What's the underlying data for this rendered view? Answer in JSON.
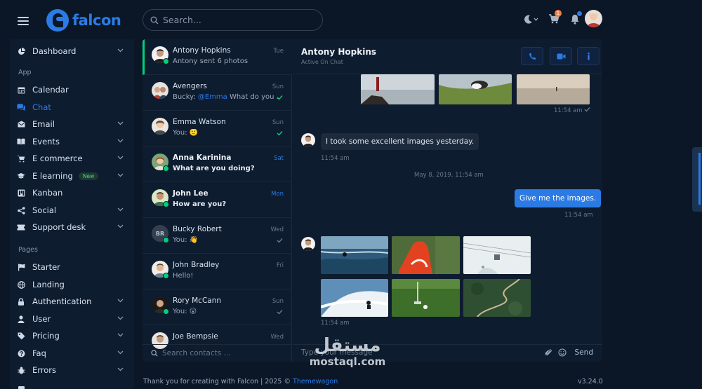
{
  "app": {
    "brand": "falcon"
  },
  "search": {
    "placeholder": "Search..."
  },
  "topbar": {
    "cart_count": "1"
  },
  "sidebar": {
    "items": [
      {
        "label": "Dashboard",
        "chev": true
      },
      {
        "label": "Calendar",
        "chev": false
      },
      {
        "label": "Chat",
        "chev": false,
        "active": true
      },
      {
        "label": "Email",
        "chev": true
      },
      {
        "label": "Events",
        "chev": true
      },
      {
        "label": "E commerce",
        "chev": true
      },
      {
        "label": "E learning",
        "chev": true,
        "badge": "New"
      },
      {
        "label": "Kanban",
        "chev": false
      },
      {
        "label": "Social",
        "chev": true
      },
      {
        "label": "Support desk",
        "chev": true
      },
      {
        "label": "Starter",
        "chev": false
      },
      {
        "label": "Landing",
        "chev": false
      },
      {
        "label": "Authentication",
        "chev": true
      },
      {
        "label": "User",
        "chev": true
      },
      {
        "label": "Pricing",
        "chev": true
      },
      {
        "label": "Faq",
        "chev": true
      },
      {
        "label": "Errors",
        "chev": true
      }
    ],
    "sections": {
      "app": "App",
      "pages": "Pages"
    }
  },
  "contacts": [
    {
      "name": "Antony Hopkins",
      "msg": "Antony sent 6 photos",
      "date": "Tue",
      "bold": false
    },
    {
      "name": "Avengers",
      "msg_prefix": "Bucky: ",
      "mention": "@Emma",
      "msg_rest": " What do you ...",
      "date": "Sun",
      "bold": false
    },
    {
      "name": "Emma Watson",
      "msg": "You: 🙂",
      "date": "Sun",
      "bold": false
    },
    {
      "name": "Anna Karinina",
      "msg": "What are you doing?",
      "date": "Sat",
      "bold": true
    },
    {
      "name": "John Lee",
      "msg": "How are you?",
      "date": "Mon",
      "bold": true
    },
    {
      "name": "Bucky Robert",
      "msg": "You: 👋",
      "date": "Wed",
      "bold": false,
      "initials": "BR"
    },
    {
      "name": "John Bradley",
      "msg": "Hello!",
      "date": "Fri",
      "bold": false
    },
    {
      "name": "Rory McCann",
      "msg": "You: 😮",
      "date": "Sun",
      "bold": false
    },
    {
      "name": "Joe Bempsie",
      "msg": "",
      "date": "Wed",
      "bold": false
    }
  ],
  "contact_search": {
    "placeholder": "Search contacts ..."
  },
  "thread": {
    "name": "Antony Hopkins",
    "status": "Active On Chat",
    "time1": "11:54 am",
    "msg_in": "I took some excellent images yesterday.",
    "time2": "11:54 am",
    "day_sep": "May 8, 2019, 11:54 am",
    "msg_out": "Give me the images.",
    "time3": "11:54 am",
    "time4": "11:54 am"
  },
  "compose": {
    "placeholder": "Type your message",
    "send": "Send"
  },
  "footer": {
    "text": "Thank you for creating with Falcon | 2025 © ",
    "link": "Themewagon",
    "version": "v3.24.0"
  },
  "watermark": {
    "ar": "مستقل",
    "en": "mostaql.com"
  },
  "colors": {
    "accent": "#2c7be5",
    "online": "#00d27a",
    "bg": "#0b1727",
    "card": "#0e1c2f"
  }
}
